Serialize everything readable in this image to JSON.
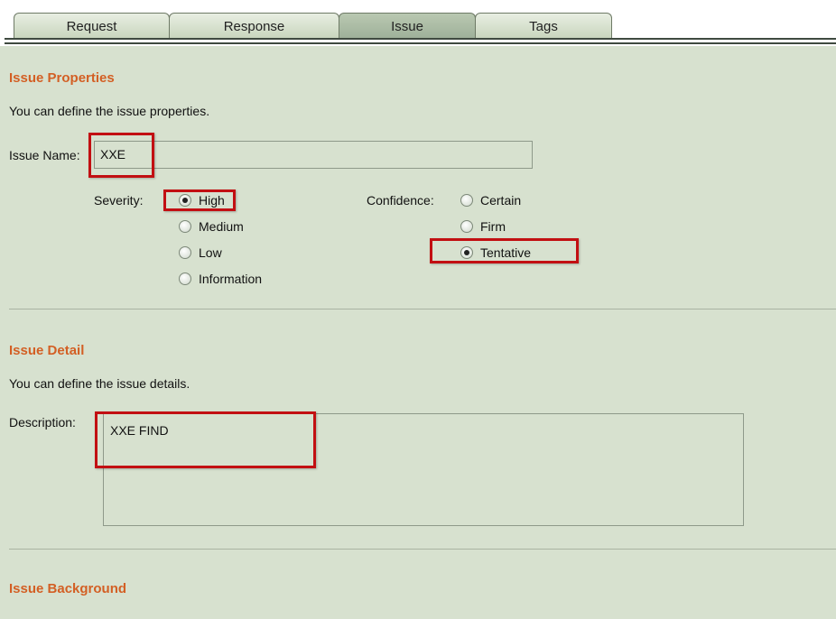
{
  "tabs": [
    {
      "label": "Request",
      "active": false
    },
    {
      "label": "Response",
      "active": false
    },
    {
      "label": "Issue",
      "active": true
    },
    {
      "label": "Tags",
      "active": false
    }
  ],
  "issue_properties": {
    "title": "Issue Properties",
    "intro": "You can define the issue properties.",
    "name_label": "Issue Name:",
    "name_value": "XXE",
    "severity_label": "Severity:",
    "severity_options": [
      "High",
      "Medium",
      "Low",
      "Information"
    ],
    "severity_selected": "High",
    "confidence_label": "Confidence:",
    "confidence_options": [
      "Certain",
      "Firm",
      "Tentative"
    ],
    "confidence_selected": "Tentative"
  },
  "issue_detail": {
    "title": "Issue Detail",
    "intro": "You can define the issue details.",
    "description_label": "Description:",
    "description_value": "XXE FIND"
  },
  "issue_background": {
    "title": "Issue Background"
  },
  "colors": {
    "panel_bg": "#d7e1cf",
    "section_title": "#d35f24",
    "highlight": "#c20f12"
  }
}
